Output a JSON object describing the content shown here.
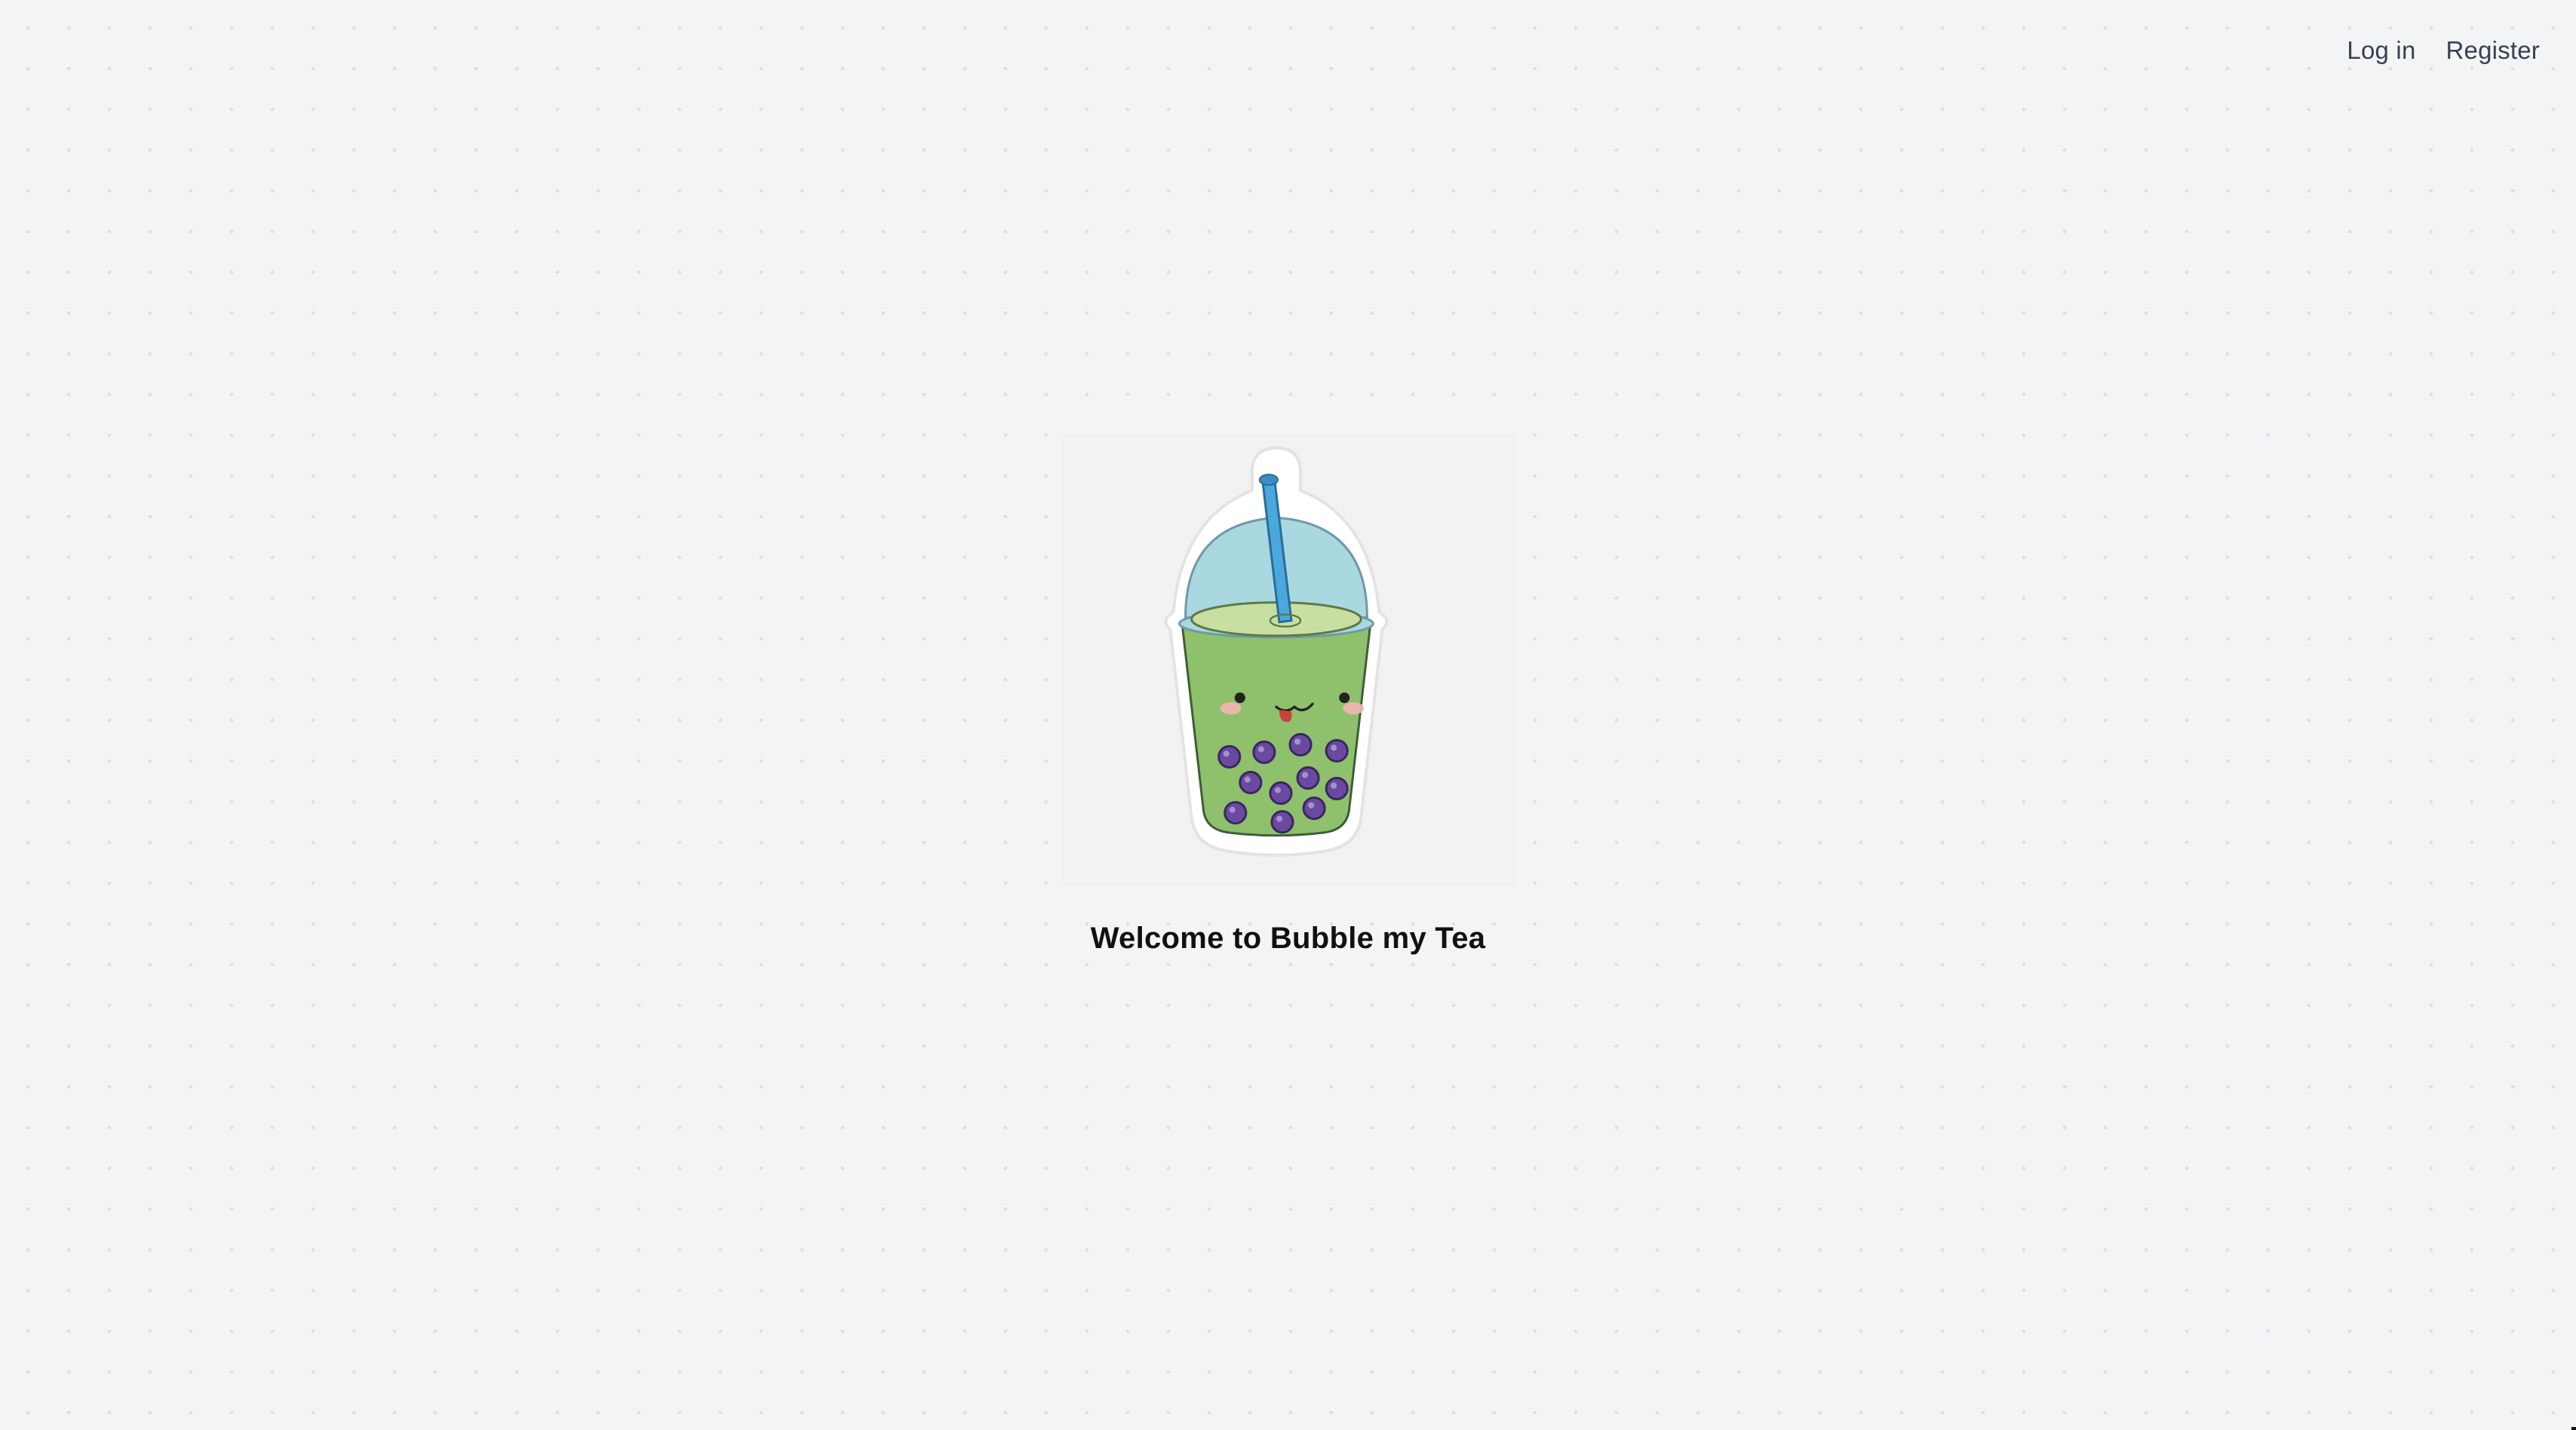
{
  "nav": {
    "login_label": "Log in",
    "register_label": "Register"
  },
  "hero": {
    "logo_icon": "bubble-tea-cup-icon",
    "welcome_text": "Welcome to Bubble my Tea"
  },
  "colors": {
    "background": "#f3f4f6",
    "tea_green": "#8fc06b",
    "lid_blue": "#a9d8e0",
    "straw_blue": "#4aa8de",
    "pearl_purple": "#6a4aa0",
    "text_dark": "#111111",
    "nav_text": "#374151"
  }
}
